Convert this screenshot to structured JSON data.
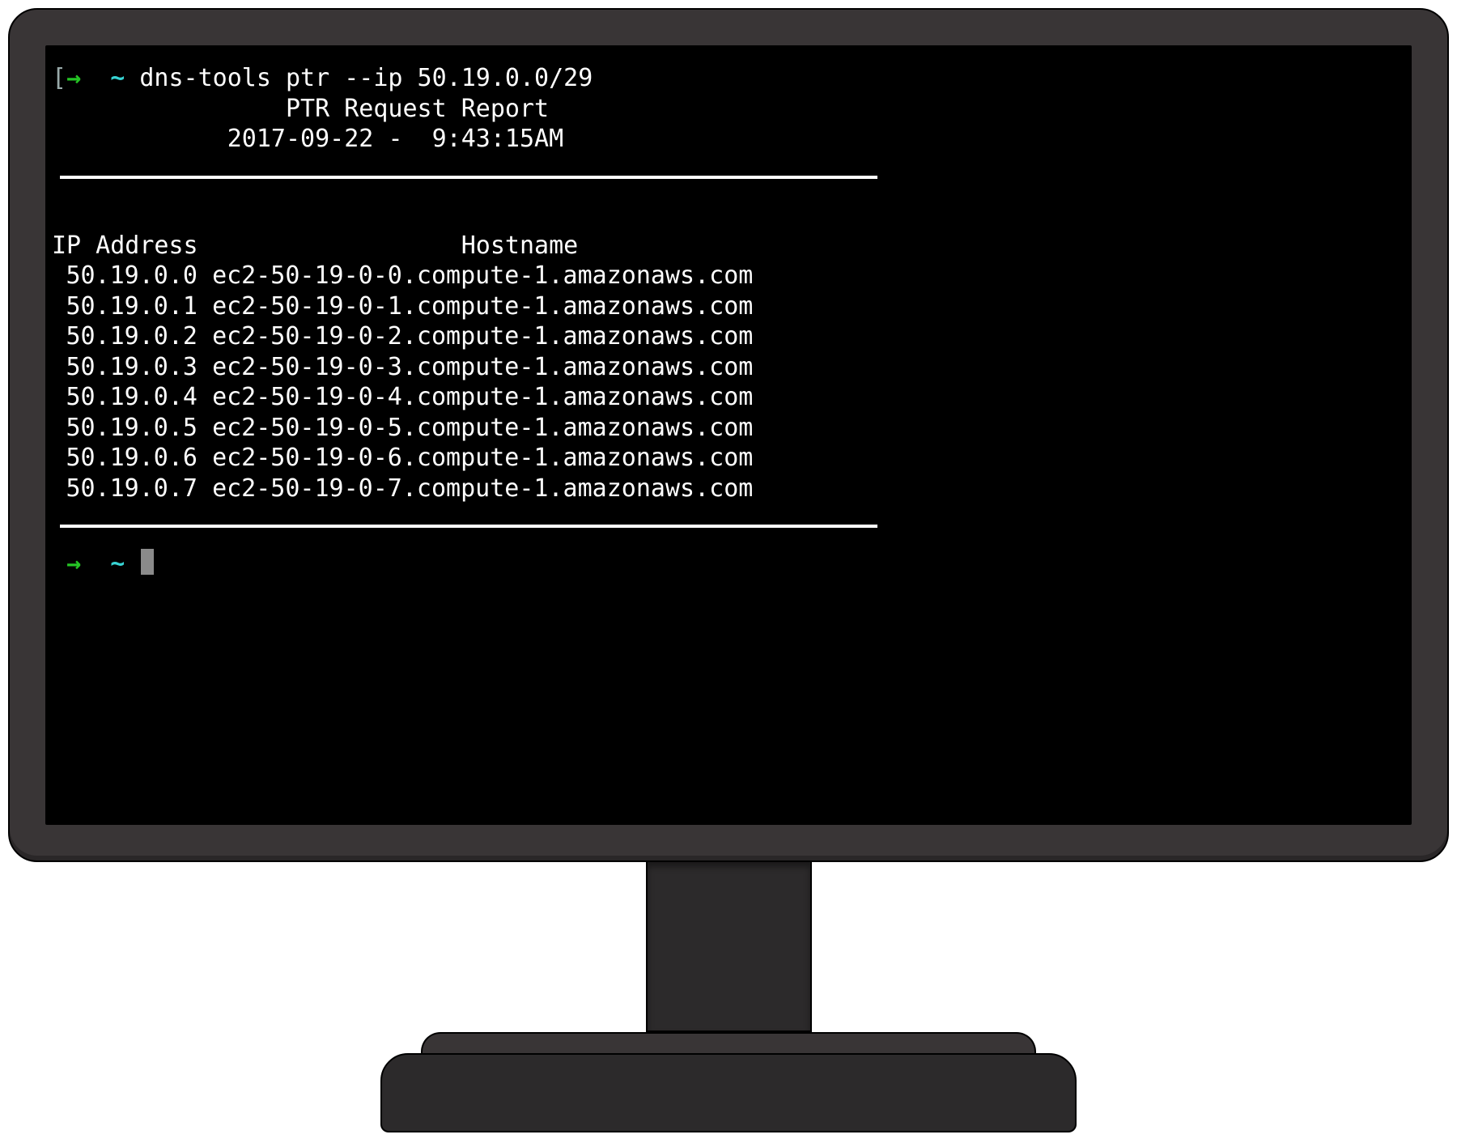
{
  "prompt": {
    "bracket_open": "[",
    "arrow": "→",
    "tilde": "~",
    "command": "dns-tools ptr --ip 50.19.0.0/29"
  },
  "report": {
    "title": "PTR Request Report",
    "date": "2017-09-22",
    "separator": "-",
    "time": "9:43:15AM"
  },
  "headers": {
    "ip": "IP Address",
    "hostname": "Hostname"
  },
  "rows": [
    {
      "ip": "50.19.0.0",
      "hostname": "ec2-50-19-0-0.compute-1.amazonaws.com"
    },
    {
      "ip": "50.19.0.1",
      "hostname": "ec2-50-19-0-1.compute-1.amazonaws.com"
    },
    {
      "ip": "50.19.0.2",
      "hostname": "ec2-50-19-0-2.compute-1.amazonaws.com"
    },
    {
      "ip": "50.19.0.3",
      "hostname": "ec2-50-19-0-3.compute-1.amazonaws.com"
    },
    {
      "ip": "50.19.0.4",
      "hostname": "ec2-50-19-0-4.compute-1.amazonaws.com"
    },
    {
      "ip": "50.19.0.5",
      "hostname": "ec2-50-19-0-5.compute-1.amazonaws.com"
    },
    {
      "ip": "50.19.0.6",
      "hostname": "ec2-50-19-0-6.compute-1.amazonaws.com"
    },
    {
      "ip": "50.19.0.7",
      "hostname": "ec2-50-19-0-7.compute-1.amazonaws.com"
    }
  ],
  "prompt2": {
    "arrow": "→",
    "tilde": "~"
  }
}
